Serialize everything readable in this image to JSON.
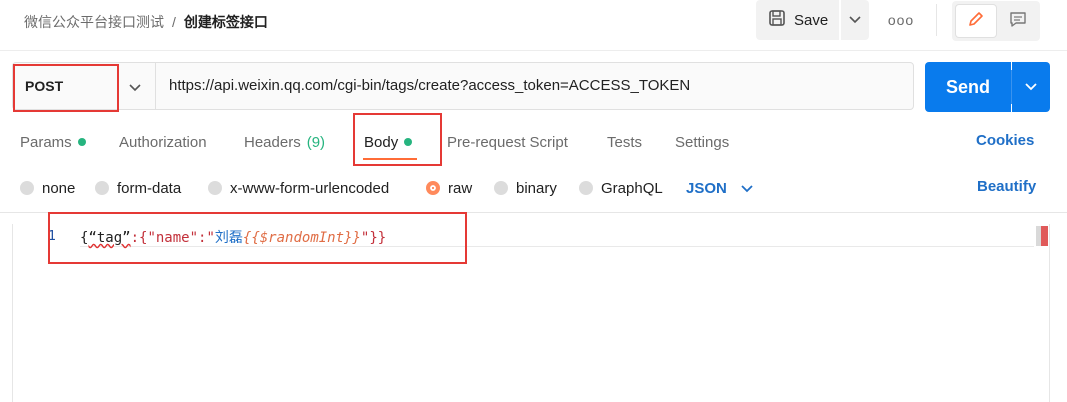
{
  "breadcrumb": {
    "parent": "微信公众平台接口测试",
    "separator": "/",
    "current": "创建标签接口"
  },
  "toolbar": {
    "save_label": "Save",
    "more_label": "ooo"
  },
  "request": {
    "method": "POST",
    "url": "https://api.weixin.qq.com/cgi-bin/tags/create?access_token=ACCESS_TOKEN",
    "send_label": "Send"
  },
  "tabs": [
    {
      "label": "Params",
      "dot": true
    },
    {
      "label": "Authorization"
    },
    {
      "label": "Headers",
      "count": "(9)"
    },
    {
      "label": "Body",
      "dot": true,
      "active": true
    },
    {
      "label": "Pre-request Script"
    },
    {
      "label": "Tests"
    },
    {
      "label": "Settings"
    }
  ],
  "cookies_label": "Cookies",
  "body_types": [
    {
      "label": "none",
      "selected": false
    },
    {
      "label": "form-data",
      "selected": false
    },
    {
      "label": "x-www-form-urlencoded",
      "selected": false
    },
    {
      "label": "raw",
      "selected": true
    },
    {
      "label": "binary",
      "selected": false
    },
    {
      "label": "GraphQL",
      "selected": false
    }
  ],
  "body_format": "JSON",
  "beautify_label": "Beautify",
  "editor": {
    "line_number": "1",
    "code": {
      "open": "{",
      "key": "“tag”",
      "mid": ":{\"name\":\"",
      "cjk": "刘磊",
      "var": "{{$randomInt}}",
      "close": "\"}}"
    }
  },
  "colors": {
    "accent": "#097bed",
    "active_tab_underline": "#ff6c37",
    "status_dot": "#26b47f",
    "link": "#1f6fc7",
    "annotation_box": "#e53935"
  }
}
